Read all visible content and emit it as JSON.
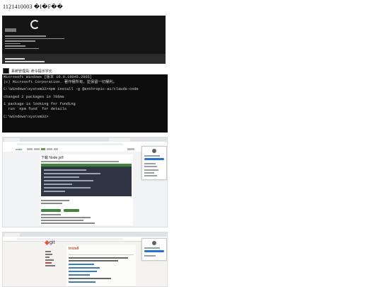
{
  "page": {
    "title": "1121410003 �I�F��"
  },
  "terminal": {
    "window_title": "系統管理員: 命令提示字元",
    "lines": [
      "Microsoft Windows [版本 10.0.19045.2965]",
      "(c) Microsoft Corporation. 著作權所有，並保留一切權利。",
      "",
      "C:\\Windows\\system32>npm install -g @anthropic-ai/claude-code",
      "",
      "changed 2 packages in 706ms",
      "",
      "1 package is looking for funding",
      "  run `npm fund` for details",
      "",
      "C:\\Windows\\system32>"
    ]
  },
  "browser_node": {
    "page_heading": "下載 Node.js®"
  },
  "browser_git": {
    "page_heading": "Install"
  },
  "colors": {
    "node_green": "#3c873a",
    "git_orange": "#f05033",
    "terminal_bg": "#0c0c0c",
    "chrome_blue": "#1a73e8"
  }
}
